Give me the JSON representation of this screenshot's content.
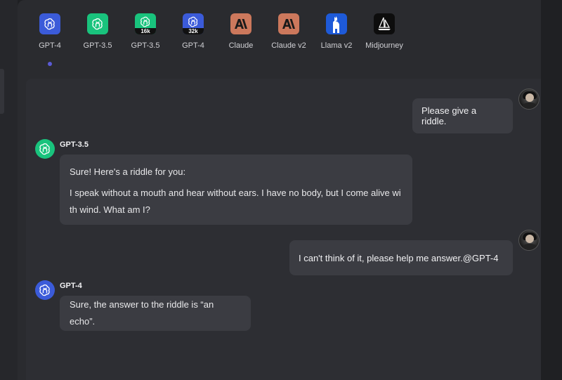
{
  "models": [
    {
      "name": "GPT-4",
      "logo": "openai-logo",
      "color": "#3b5bd9",
      "badge": "",
      "selected": true
    },
    {
      "name": "GPT-3.5",
      "logo": "openai-logo",
      "color": "#19c37d",
      "badge": "",
      "selected": false
    },
    {
      "name": "GPT-3.5",
      "logo": "openai-logo",
      "color": "#19c37d",
      "badge": "16k",
      "selected": false
    },
    {
      "name": "GPT-4",
      "logo": "openai-logo",
      "color": "#3b5bd9",
      "badge": "32k",
      "selected": false
    },
    {
      "name": "Claude",
      "logo": "anthropic-logo",
      "color": "#cc785c",
      "badge": "",
      "selected": false
    },
    {
      "name": "Claude v2",
      "logo": "anthropic-logo",
      "color": "#cc785c",
      "badge": "",
      "selected": false
    },
    {
      "name": "Llama v2",
      "logo": "llama-logo",
      "color": "#1e5ad8",
      "badge": "",
      "selected": false
    },
    {
      "name": "Midjourney",
      "logo": "sailboat-logo",
      "color": "#0d0d0d",
      "badge": "",
      "selected": false
    }
  ],
  "messages": {
    "user1": "Please give a riddle.",
    "bot1_name": "GPT-3.5",
    "bot1_line1": "Sure! Here's a riddle for you:",
    "bot1_line2a": "I speak without a mouth and hear without ears. I have no body, but I come alive wi",
    "bot1_line2b": "th wind. What am I?",
    "user2": "I can't think of it, please help me answer.@GPT-4",
    "bot2_name": "GPT-4",
    "bot2_text": "Sure, the answer to the riddle is “an echo”."
  },
  "colors": {
    "gpt35": "#19c37d",
    "gpt4": "#3b5bd9",
    "accent_dot": "#5b5bd6"
  }
}
